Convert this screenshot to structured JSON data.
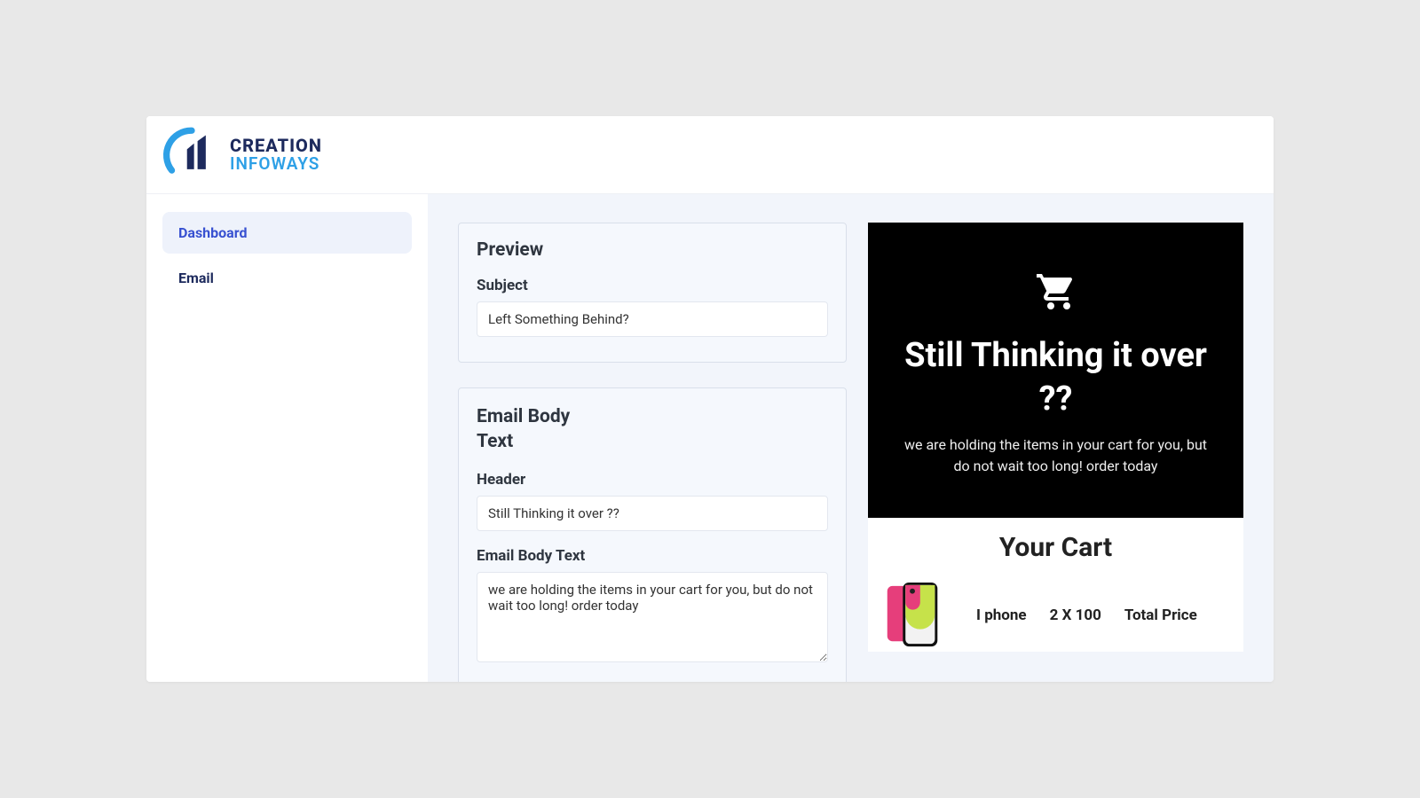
{
  "brand": {
    "line1": "CREATION",
    "line2": "INFOWAYS"
  },
  "sidebar": {
    "items": [
      {
        "label": "Dashboard",
        "active": true
      },
      {
        "label": "Email",
        "active": false
      }
    ]
  },
  "form": {
    "preview": {
      "title": "Preview",
      "subject_label": "Subject",
      "subject_value": "Left Something Behind?"
    },
    "body": {
      "title_l1": "Email Body",
      "title_l2": "Text",
      "header_label": "Header",
      "header_value": "Still Thinking it over ??",
      "text_label": "Email Body Text",
      "text_value": "we are holding the items in your cart for you, but do not wait too long! order today"
    }
  },
  "email_preview": {
    "hero_title": "Still Thinking it over ??",
    "hero_sub": "we are holding the items in your cart for you, but do not wait too long! order today",
    "cart_title": "Your Cart",
    "cart_item": {
      "name": "I phone",
      "qty_price": "2 X 100",
      "total_label": "Total Price"
    }
  }
}
